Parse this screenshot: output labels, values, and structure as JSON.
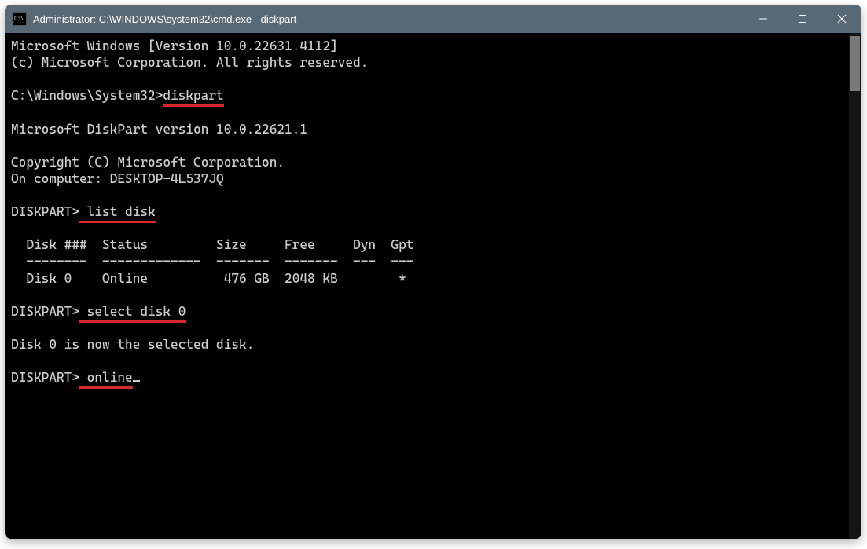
{
  "window": {
    "title": "Administrator: C:\\WINDOWS\\system32\\cmd.exe - diskpart"
  },
  "terminal": {
    "header_line1": "Microsoft Windows [Version 10.0.22631.4112]",
    "header_line2": "(c) Microsoft Corporation. All rights reserved.",
    "prompt1_prefix": "C:\\Windows\\System32>",
    "prompt1_cmd": "diskpart",
    "diskpart_version": "Microsoft DiskPart version 10.0.22621.1",
    "copyright": "Copyright (C) Microsoft Corporation.",
    "on_computer": "On computer: DESKTOP-4L537JQ",
    "prompt2_prefix": "DISKPART>",
    "prompt2_cmd": " list disk",
    "disk_header": "  Disk ###  Status         Size     Free     Dyn  Gpt",
    "disk_divider": "  --------  -------------  -------  -------  ---  ---",
    "disk_row0": "  Disk 0    Online          476 GB  2048 KB        *",
    "prompt3_prefix": "DISKPART>",
    "prompt3_cmd": " select disk 0",
    "select_msg": "Disk 0 is now the selected disk.",
    "prompt4_prefix": "DISKPART>",
    "prompt4_cmd": " online"
  },
  "chart_data": {
    "type": "table",
    "title": "diskpart list disk",
    "columns": [
      "Disk ###",
      "Status",
      "Size",
      "Free",
      "Dyn",
      "Gpt"
    ],
    "rows": [
      {
        "Disk ###": "Disk 0",
        "Status": "Online",
        "Size": "476 GB",
        "Free": "2048 KB",
        "Dyn": "",
        "Gpt": "*"
      }
    ]
  }
}
